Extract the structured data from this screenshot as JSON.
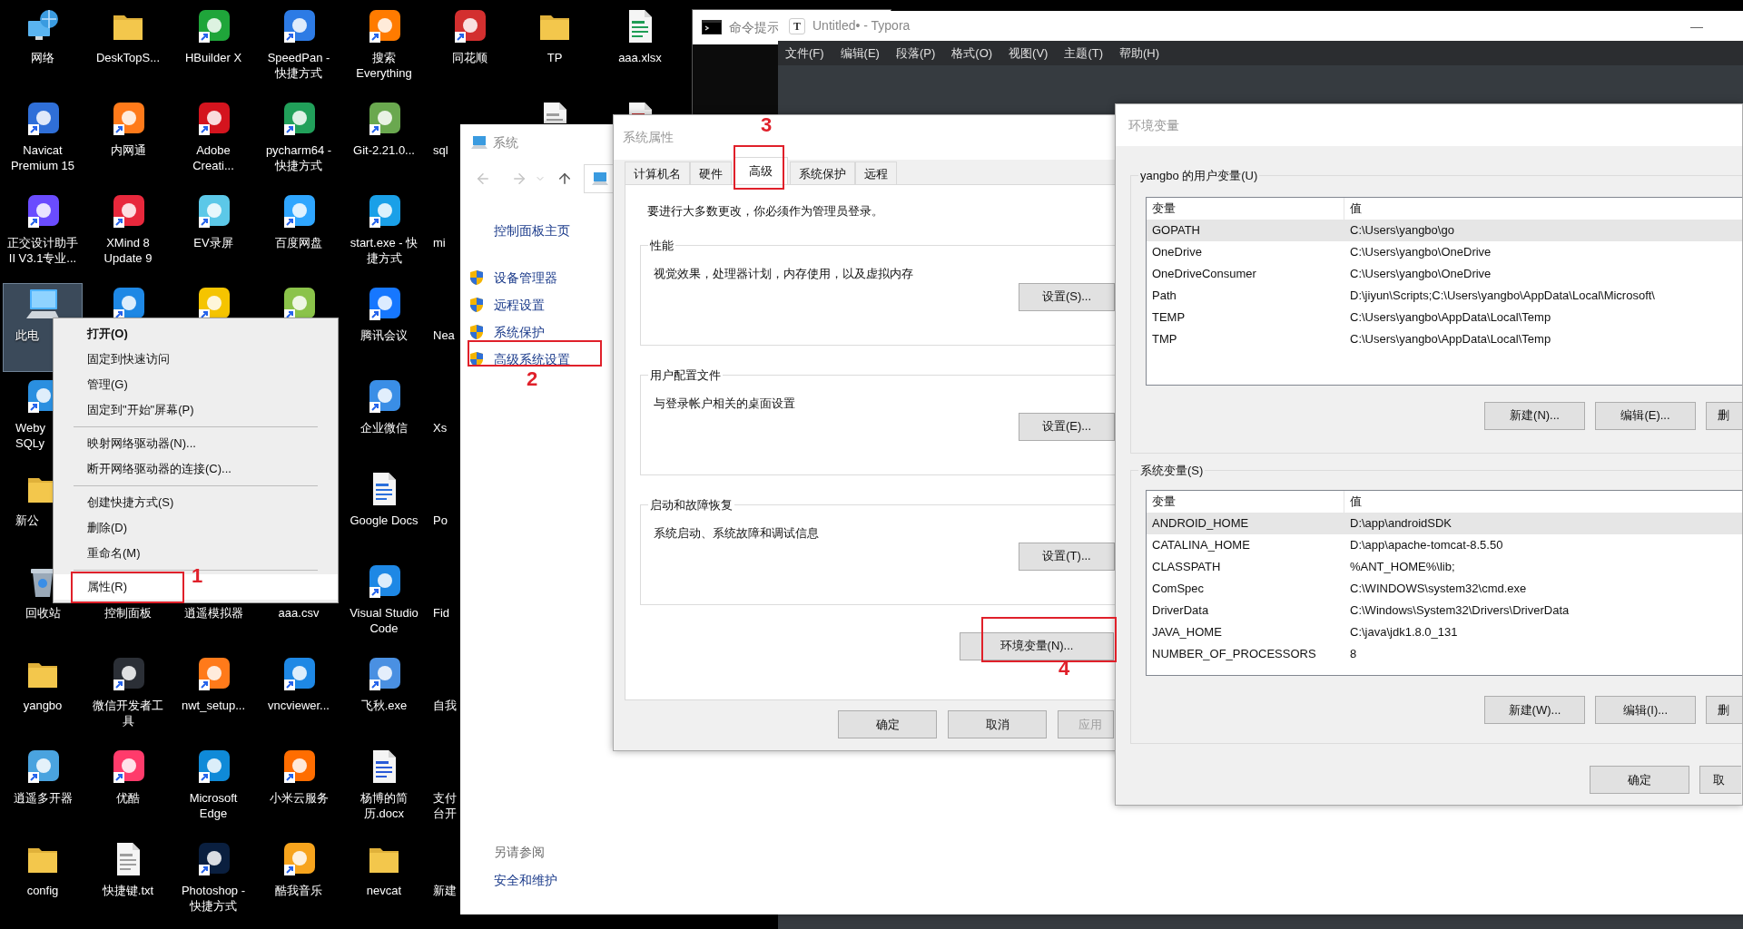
{
  "desktop": {
    "columns": [
      [
        {
          "kind": "full",
          "label": "网络",
          "selected": false
        },
        {
          "kind": "full",
          "label": "Navicat Premium 15",
          "selected": false
        },
        {
          "kind": "full",
          "label": "正交设计助手 II V3.1专业...",
          "selected": false
        },
        {
          "kind": "partial",
          "label": "此电",
          "selected": true
        },
        {
          "kind": "partial",
          "label": "Weby SQLy",
          "selected": false
        },
        {
          "kind": "partial",
          "label": "新公",
          "selected": false
        },
        {
          "kind": "full",
          "label": "回收站",
          "selected": false
        },
        {
          "kind": "full",
          "label": "yangbo",
          "selected": false
        },
        {
          "kind": "full",
          "label": "逍遥多开器",
          "selected": false
        },
        {
          "kind": "full",
          "label": "config",
          "selected": false
        }
      ],
      [
        {
          "kind": "full",
          "label": "DeskTopS...",
          "selected": false
        },
        {
          "kind": "full",
          "label": "内网通",
          "selected": false
        },
        {
          "kind": "full",
          "label": "XMind 8 Update 9",
          "selected": false
        },
        {
          "kind": "bare",
          "selected": false
        },
        {
          "kind": "full",
          "label": "控制面板",
          "selected": false
        },
        {
          "kind": "full",
          "label": "微信开发者工具",
          "selected": false
        },
        {
          "kind": "full",
          "label": "优酷",
          "selected": false
        },
        {
          "kind": "full",
          "label": "快捷键.txt",
          "selected": false
        }
      ],
      [
        {
          "kind": "full",
          "label": "HBuilder X",
          "selected": false
        },
        {
          "kind": "full",
          "label": "Adobe Creati...",
          "selected": false
        },
        {
          "kind": "full",
          "label": "EV录屏",
          "selected": false
        },
        {
          "kind": "bare",
          "selected": false
        },
        {
          "kind": "full",
          "label": "逍遥模拟器",
          "selected": false
        },
        {
          "kind": "full",
          "label": "nwt_setup...",
          "selected": false
        },
        {
          "kind": "full",
          "label": "Microsoft Edge",
          "selected": false
        },
        {
          "kind": "full",
          "label": "Photoshop - 快捷方式",
          "selected": false
        }
      ],
      [
        {
          "kind": "full",
          "label": "SpeedPan - 快捷方式",
          "selected": false
        },
        {
          "kind": "full",
          "label": "pycharm64 - 快捷方式",
          "selected": false
        },
        {
          "kind": "full",
          "label": "百度网盘",
          "selected": false
        },
        {
          "kind": "bare",
          "selected": false
        },
        {
          "kind": "full",
          "label": "aaa.csv",
          "selected": false
        },
        {
          "kind": "full",
          "label": "vncviewer...",
          "selected": false
        },
        {
          "kind": "full",
          "label": "小米云服务",
          "selected": false
        },
        {
          "kind": "full",
          "label": "酷我音乐",
          "selected": false
        }
      ],
      [
        {
          "kind": "full",
          "label": "搜索 Everything",
          "selected": false
        },
        {
          "kind": "full",
          "label": "Git-2.21.0...",
          "selected": false
        },
        {
          "kind": "full",
          "label": "start.exe - 快捷方式",
          "selected": false
        },
        {
          "kind": "full",
          "label": "腾讯会议",
          "selected": false
        },
        {
          "kind": "full",
          "label": "企业微信",
          "selected": false
        },
        {
          "kind": "full",
          "label": "Google Docs",
          "selected": false
        },
        {
          "kind": "full",
          "label": "Visual Studio Code",
          "selected": false
        },
        {
          "kind": "full",
          "label": "飞秋.exe",
          "selected": false
        },
        {
          "kind": "full",
          "label": "杨博的简历.docx",
          "selected": false
        },
        {
          "kind": "full",
          "label": "nevcat",
          "selected": false
        }
      ],
      [
        {
          "kind": "full",
          "label": "同花顺",
          "selected": false
        },
        {
          "kind": "partial",
          "label": "sql",
          "selected": false
        },
        {
          "kind": "partial",
          "label": "mi",
          "selected": false
        },
        {
          "kind": "partial",
          "label": "Nea",
          "selected": false
        },
        {
          "kind": "partial",
          "label": "Xs",
          "selected": false
        },
        {
          "kind": "partial",
          "label": "Po",
          "selected": false
        },
        {
          "kind": "partial",
          "label": "Fid",
          "selected": false
        },
        {
          "kind": "partial",
          "label": "自我",
          "selected": false
        },
        {
          "kind": "partial",
          "label": "支付台开",
          "selected": false
        },
        {
          "kind": "partial",
          "label": "新建",
          "selected": false
        }
      ],
      [
        {
          "kind": "full",
          "label": "TP",
          "selected": false
        },
        {
          "kind": "bare",
          "selected": false
        }
      ],
      [
        {
          "kind": "full",
          "label": "aaa.xlsx",
          "selected": false
        },
        {
          "kind": "bare",
          "selected": false
        }
      ]
    ]
  },
  "context_menu": {
    "items": [
      {
        "kind": "item",
        "label": "打开(O)",
        "bold": true,
        "highlighted": false
      },
      {
        "kind": "item",
        "label": "固定到快速访问",
        "bold": false,
        "highlighted": false
      },
      {
        "kind": "item",
        "label": "管理(G)",
        "bold": false,
        "highlighted": false
      },
      {
        "kind": "item",
        "label": "固定到\"开始\"屏幕(P)",
        "bold": false,
        "highlighted": false
      },
      {
        "kind": "separator"
      },
      {
        "kind": "item",
        "label": "映射网络驱动器(N)...",
        "bold": false,
        "highlighted": false
      },
      {
        "kind": "item",
        "label": "断开网络驱动器的连接(C)...",
        "bold": false,
        "highlighted": false
      },
      {
        "kind": "separator"
      },
      {
        "kind": "item",
        "label": "创建快捷方式(S)",
        "bold": false,
        "highlighted": false
      },
      {
        "kind": "item",
        "label": "删除(D)",
        "bold": false,
        "highlighted": false
      },
      {
        "kind": "item",
        "label": "重命名(M)",
        "bold": false,
        "highlighted": false
      },
      {
        "kind": "separator"
      },
      {
        "kind": "item",
        "label": "属性(R)",
        "bold": false,
        "highlighted": true
      }
    ]
  },
  "terminal": {
    "title": "命令提示"
  },
  "editor": {
    "icon_text": "T",
    "title": "Untitled• - Typora",
    "menu": [
      "文件(F)",
      "编辑(E)",
      "段落(P)",
      "格式(O)",
      "视图(V)",
      "主题(T)",
      "帮助(H)"
    ]
  },
  "system_window": {
    "title": "系统",
    "home_link": "控制面板主页",
    "tasks": [
      "设备管理器",
      "远程设置",
      "系统保护",
      "高级系统设置"
    ],
    "see_also": "另请参阅",
    "see_also_links": [
      "安全和维护"
    ]
  },
  "system_properties": {
    "title": "系统属性",
    "tabs": [
      {
        "label": "计算机名",
        "selected": false
      },
      {
        "label": "硬件",
        "selected": false
      },
      {
        "label": "高级",
        "selected": true
      },
      {
        "label": "系统保护",
        "selected": false
      },
      {
        "label": "远程",
        "selected": false
      }
    ],
    "notice": "要进行大多数更改，你必须作为管理员登录。",
    "groups": [
      {
        "title": "性能",
        "description": "视觉效果，处理器计划，内存使用，以及虚拟内存",
        "button": "设置(S)..."
      },
      {
        "title": "用户配置文件",
        "description": "与登录帐户相关的桌面设置",
        "button": "设置(E)..."
      },
      {
        "title": "启动和故障恢复",
        "description": "系统启动、系统故障和调试信息",
        "button": "设置(T)..."
      }
    ],
    "env_button": "环境变量(N)...",
    "buttons": [
      {
        "label": "确定",
        "disabled": false
      },
      {
        "label": "取消",
        "disabled": false
      },
      {
        "label": "应用",
        "disabled": true
      }
    ]
  },
  "environment_variables": {
    "title": "环境变量",
    "user": {
      "title": "yangbo 的用户变量(U)",
      "columns": [
        "变量",
        "值"
      ],
      "rows": [
        {
          "name": "GOPATH",
          "value": "C:\\Users\\yangbo\\go",
          "selected": true
        },
        {
          "name": "OneDrive",
          "value": "C:\\Users\\yangbo\\OneDrive",
          "selected": false
        },
        {
          "name": "OneDriveConsumer",
          "value": "C:\\Users\\yangbo\\OneDrive",
          "selected": false
        },
        {
          "name": "Path",
          "value": "D:\\jiyun\\Scripts;C:\\Users\\yangbo\\AppData\\Local\\Microsoft\\",
          "selected": false
        },
        {
          "name": "TEMP",
          "value": "C:\\Users\\yangbo\\AppData\\Local\\Temp",
          "selected": false
        },
        {
          "name": "TMP",
          "value": "C:\\Users\\yangbo\\AppData\\Local\\Temp",
          "selected": false
        }
      ],
      "buttons": [
        "新建(N)...",
        "编辑(E)...",
        "删"
      ]
    },
    "system": {
      "title": "系统变量(S)",
      "columns": [
        "变量",
        "值"
      ],
      "rows": [
        {
          "name": "ANDROID_HOME",
          "value": "D:\\app\\androidSDK",
          "selected": true
        },
        {
          "name": "CATALINA_HOME",
          "value": "D:\\app\\apache-tomcat-8.5.50",
          "selected": false
        },
        {
          "name": "CLASSPATH",
          "value": "%ANT_HOME%\\lib;",
          "selected": false
        },
        {
          "name": "ComSpec",
          "value": "C:\\WINDOWS\\system32\\cmd.exe",
          "selected": false
        },
        {
          "name": "DriverData",
          "value": "C:\\Windows\\System32\\Drivers\\DriverData",
          "selected": false
        },
        {
          "name": "JAVA_HOME",
          "value": "C:\\java\\jdk1.8.0_131",
          "selected": false
        },
        {
          "name": "NUMBER_OF_PROCESSORS",
          "value": "8",
          "selected": false
        }
      ],
      "buttons": [
        "新建(W)...",
        "编辑(I)...",
        "删"
      ]
    },
    "buttons": [
      "确定",
      "取"
    ]
  },
  "annotations": [
    {
      "label": "1"
    },
    {
      "label": "2"
    },
    {
      "label": "3"
    },
    {
      "label": "4"
    }
  ]
}
